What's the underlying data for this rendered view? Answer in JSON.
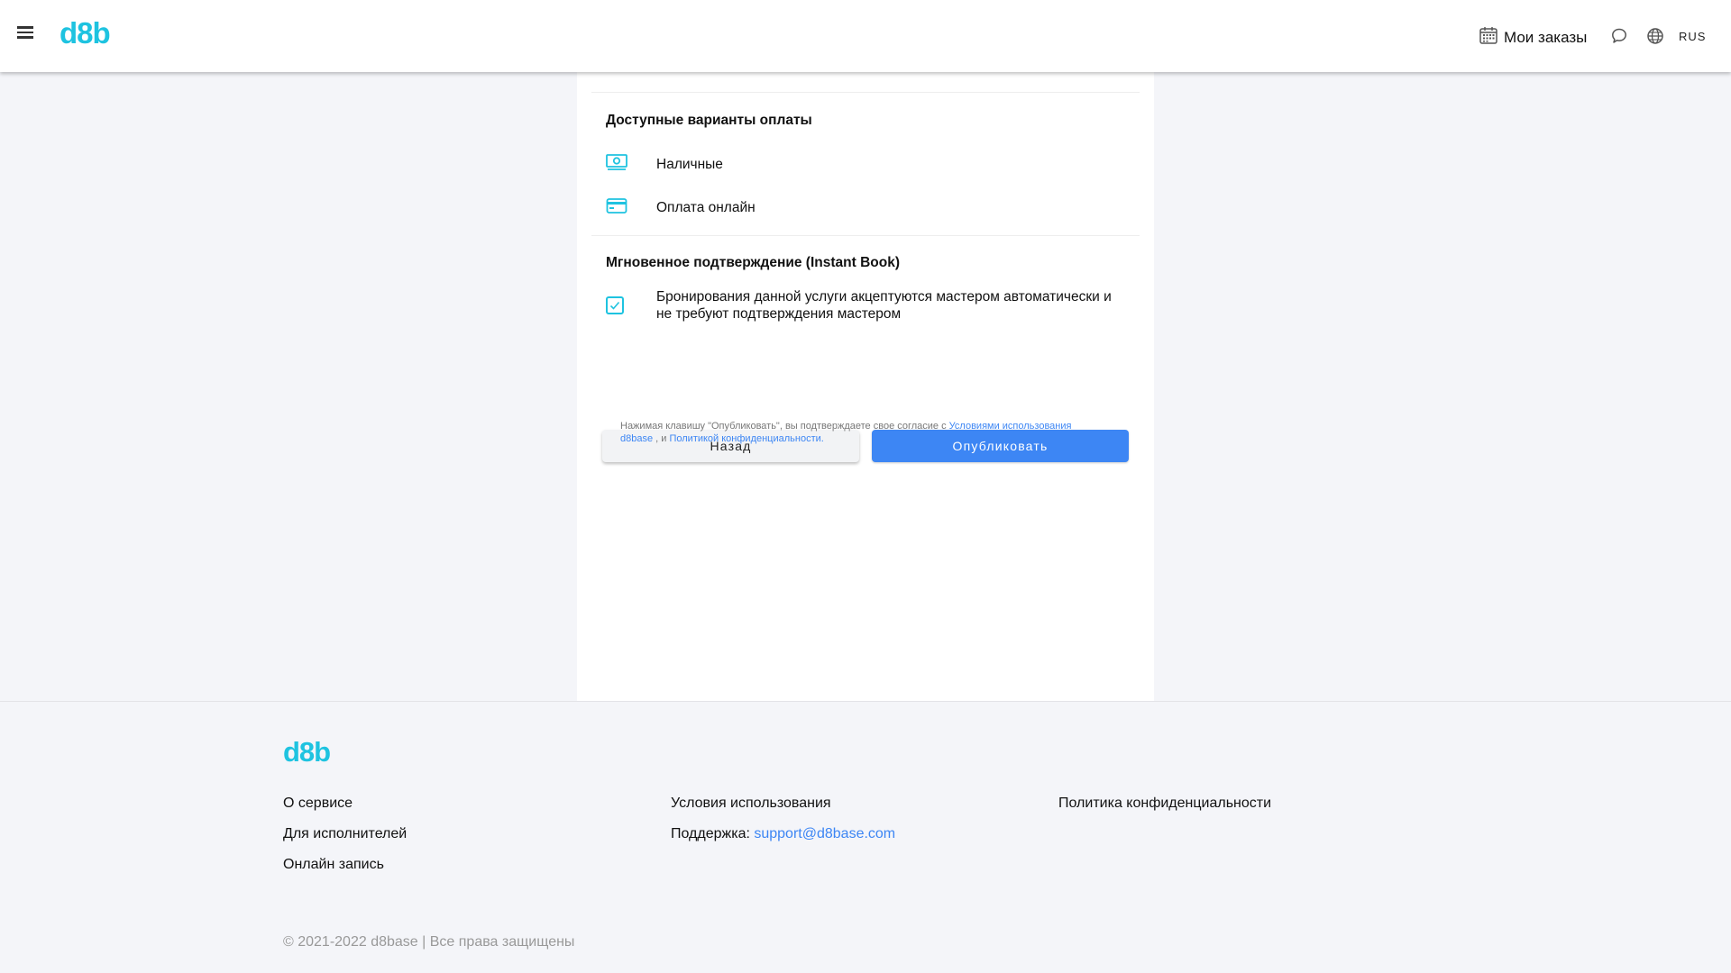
{
  "header": {
    "logo": "d8b",
    "orders_label": "Мои заказы",
    "lang": "RUS"
  },
  "payment": {
    "title": "Доступные варианты оплаты",
    "options": [
      {
        "label": "Наличные",
        "icon": "cash-icon"
      },
      {
        "label": "Оплата онлайн",
        "icon": "credit-card-icon"
      }
    ]
  },
  "instant_book": {
    "title": "Мгновенное подтверждение (Instant Book)",
    "description": "Бронирования данной услуги акцептуются мастером автоматически и не требуют подтверждения мастером",
    "checked": true
  },
  "actions": {
    "back_label": "Назад",
    "publish_label": "Опубликовать"
  },
  "agreement": {
    "prefix": "Нажимая клавишу \"Опубликовать\", вы подтверждаете свое согласие с ",
    "terms_link": "Условиями использования d8base",
    "middle": " , и ",
    "privacy_link": "Политикой конфиденциальности."
  },
  "footer": {
    "logo": "d8b",
    "about": "О сервисе",
    "for_providers": "Для исполнителей",
    "online_booking": "Онлайн запись",
    "terms": "Условия использования",
    "support_label": "Поддержка: ",
    "support_email": "support@d8base.com",
    "privacy": "Политика конфиденциальности",
    "copyright": "© 2021-2022 d8base | Все права защищены"
  },
  "colors": {
    "brand": "#1ec3e0",
    "primary": "#3d86f4",
    "background": "#f4f5f9"
  }
}
